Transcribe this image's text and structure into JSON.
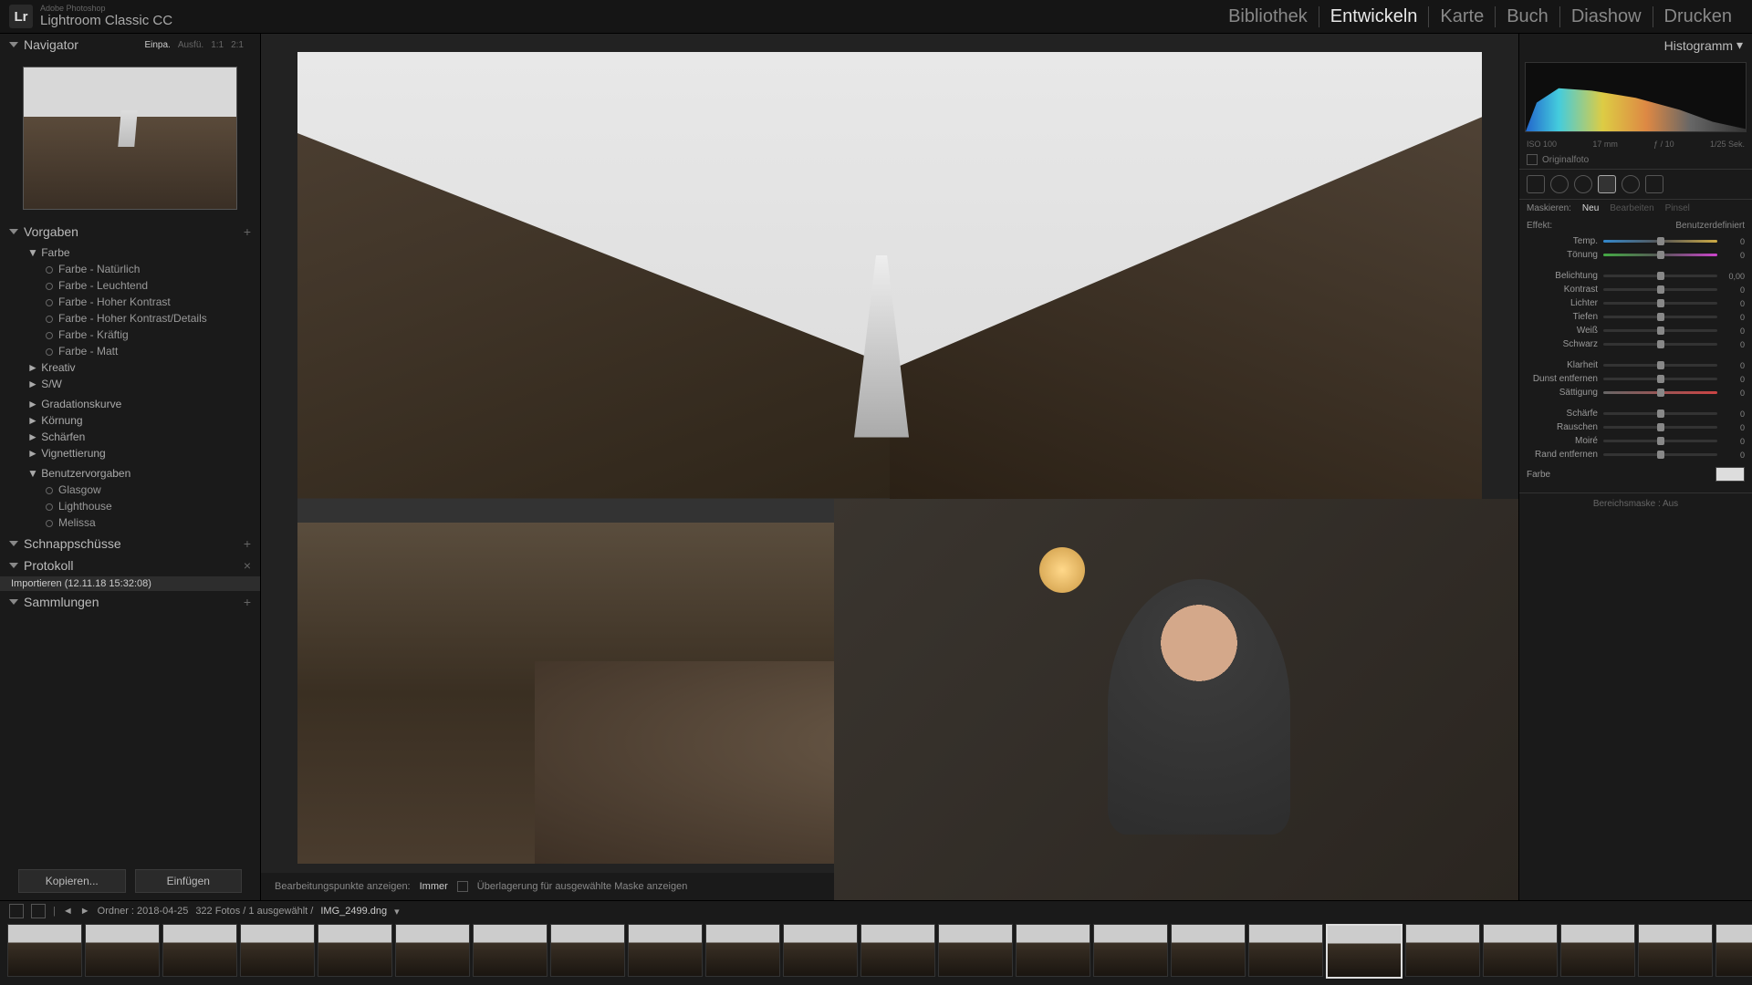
{
  "brand": {
    "sub": "Adobe Photoshop",
    "main": "Lightroom Classic CC"
  },
  "modules": {
    "items": [
      "Bibliothek",
      "Entwickeln",
      "Karte",
      "Buch",
      "Diashow",
      "Drucken"
    ],
    "active": 1
  },
  "left": {
    "navigator": {
      "title": "Navigator",
      "opts": [
        "Einpa.",
        "Ausfü.",
        "1:1",
        "2:1"
      ]
    },
    "presets": {
      "title": "Vorgaben",
      "farbe": {
        "label": "Farbe",
        "items": [
          "Farbe - Natürlich",
          "Farbe - Leuchtend",
          "Farbe - Hoher Kontrast",
          "Farbe - Hoher Kontrast/Details",
          "Farbe - Kräftig",
          "Farbe - Matt"
        ]
      },
      "kreativ": "Kreativ",
      "sw": "S/W",
      "grad": "Gradationskurve",
      "korn": "Körnung",
      "scharf": "Schärfen",
      "vign": "Vignettierung",
      "user": {
        "label": "Benutzervorgaben",
        "items": [
          "Glasgow",
          "Lighthouse",
          "Melissa"
        ]
      }
    },
    "snapshots": "Schnappschüsse",
    "history": {
      "title": "Protokoll",
      "item": "Importieren (12.11.18 15:32:08)"
    },
    "collections": "Sammlungen",
    "btns": {
      "copy": "Kopieren...",
      "paste": "Einfügen"
    }
  },
  "center": {
    "bottombar": {
      "label": "Bearbeitungspunkte anzeigen:",
      "mode": "Immer",
      "overlay": "Überlagerung für ausgewählte Maske anzeigen"
    }
  },
  "right": {
    "histo_title": "Histogramm",
    "histo_info": {
      "iso": "ISO 100",
      "focal": "17 mm",
      "aperture": "ƒ / 10",
      "shutter": "1/25 Sek."
    },
    "original": "Originalfoto",
    "mask": {
      "label": "Maskieren:",
      "neu": "Neu",
      "bearb": "Bearbeiten",
      "pinsel": "Pinsel"
    },
    "effect": {
      "label": "Effekt:",
      "val": "Benutzerdefiniert"
    },
    "sliders": [
      {
        "label": "Temp.",
        "val": "0",
        "cls": "temp"
      },
      {
        "label": "Tönung",
        "val": "0",
        "cls": "tint"
      },
      {
        "label": "Belichtung",
        "val": "0,00",
        "cls": ""
      },
      {
        "label": "Kontrast",
        "val": "0",
        "cls": ""
      },
      {
        "label": "Lichter",
        "val": "0",
        "cls": ""
      },
      {
        "label": "Tiefen",
        "val": "0",
        "cls": ""
      },
      {
        "label": "Weiß",
        "val": "0",
        "cls": ""
      },
      {
        "label": "Schwarz",
        "val": "0",
        "cls": ""
      },
      {
        "label": "Klarheit",
        "val": "0",
        "cls": ""
      },
      {
        "label": "Dunst entfernen",
        "val": "0",
        "cls": ""
      },
      {
        "label": "Sättigung",
        "val": "0",
        "cls": "sat"
      },
      {
        "label": "Schärfe",
        "val": "0",
        "cls": ""
      },
      {
        "label": "Rauschen",
        "val": "0",
        "cls": ""
      },
      {
        "label": "Moiré",
        "val": "0",
        "cls": ""
      },
      {
        "label": "Rand entfernen",
        "val": "0",
        "cls": ""
      }
    ],
    "color": "Farbe",
    "range": "Bereichsmaske : Aus"
  },
  "filmstrip": {
    "info": {
      "folder": "Ordner : 2018-04-25",
      "count": "322 Fotos / 1 ausgewählt /",
      "file": "IMG_2499.dng"
    },
    "thumbs": 23,
    "selected": 17
  }
}
